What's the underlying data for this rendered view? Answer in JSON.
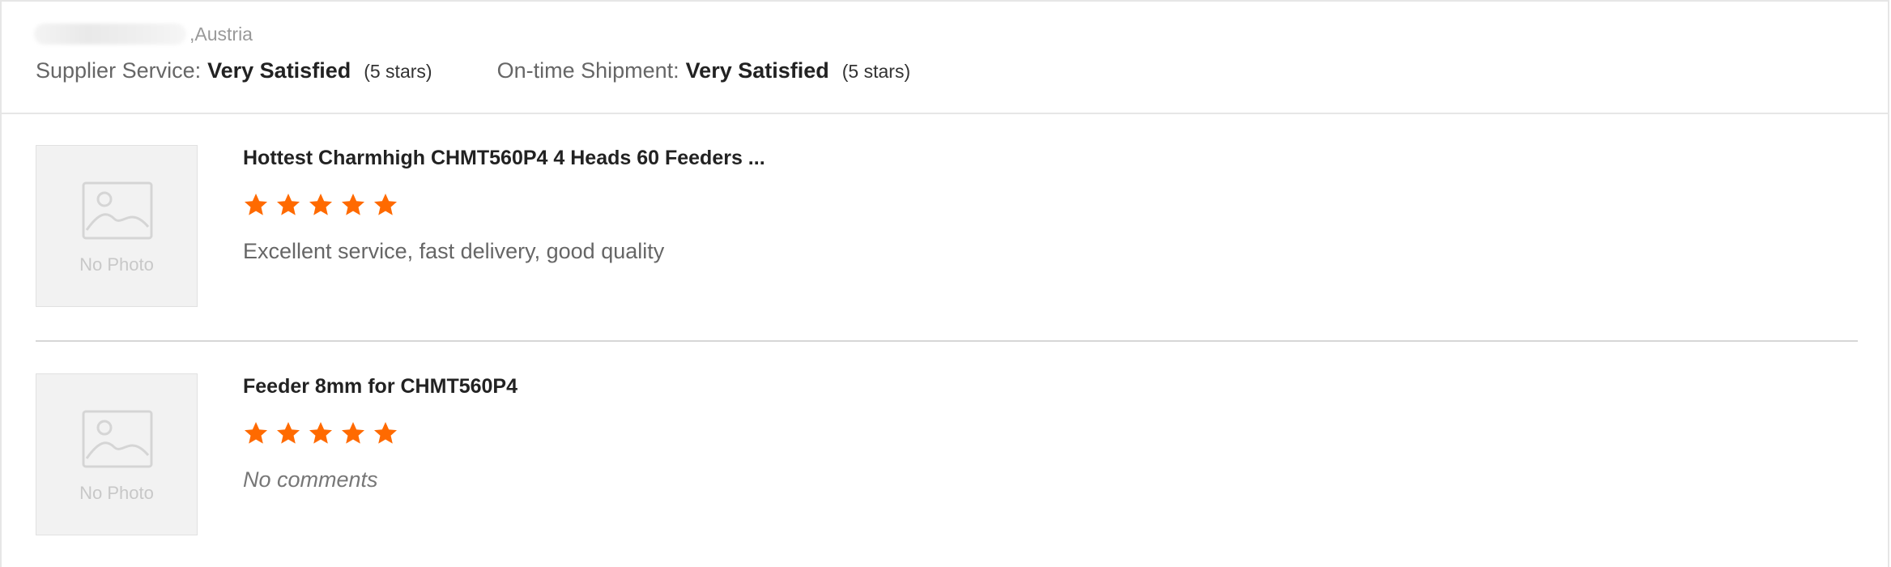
{
  "buyer": {
    "country": ",Austria"
  },
  "ratings": {
    "supplier_service": {
      "label": "Supplier Service:",
      "value": "Very Satisfied",
      "stars_text": "(5 stars)"
    },
    "on_time_shipment": {
      "label": "On-time Shipment:",
      "value": "Very Satisfied",
      "stars_text": "(5 stars)"
    }
  },
  "colors": {
    "star": "#ff6a00"
  },
  "reviews": [
    {
      "product_title": "Hottest Charmhigh CHMT560P4 4 Heads 60 Feeders ...",
      "photo_label": "No Photo",
      "rating": 5,
      "comment": "Excellent service, fast delivery, good quality"
    },
    {
      "product_title": "Feeder 8mm for CHMT560P4",
      "photo_label": "No Photo",
      "rating": 5,
      "comment": "No comments"
    }
  ],
  "icons": {
    "photo_placeholder": "image-placeholder-icon",
    "star": "star-icon"
  }
}
